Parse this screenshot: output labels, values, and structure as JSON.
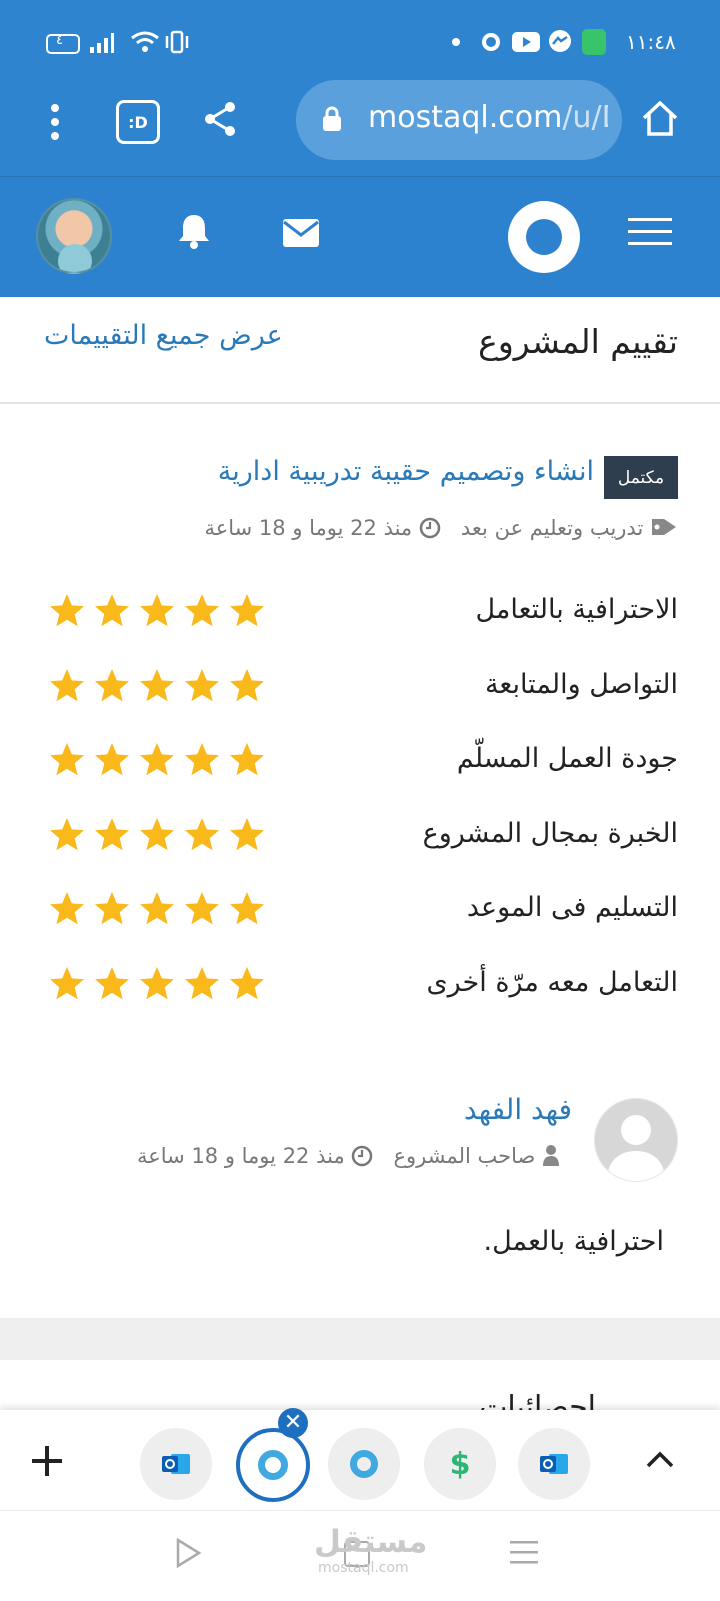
{
  "status_bar": {
    "time": "١١:٤٨",
    "battery_level": "٤"
  },
  "browser": {
    "url_main": "mostaql.com",
    "url_rest": "/u/D"
  },
  "section": {
    "title": "تقييم المشروع",
    "view_all_link": "عرض جميع التقييمات"
  },
  "project": {
    "status_badge": "مكتمل",
    "title": "انشاء وتصميم حقيبة تدريبية ادارية",
    "category": "تدريب وتعليم عن بعد",
    "time_ago": "منذ 22 يوما و 18 ساعة"
  },
  "ratings": [
    {
      "label": "الاحترافية بالتعامل",
      "stars": 5
    },
    {
      "label": "التواصل والمتابعة",
      "stars": 5
    },
    {
      "label": "جودة العمل المسلّم",
      "stars": 5
    },
    {
      "label": "الخبرة بمجال المشروع",
      "stars": 5
    },
    {
      "label": "التسليم فى الموعد",
      "stars": 5
    },
    {
      "label": "التعامل معه مرّة أخرى",
      "stars": 5
    }
  ],
  "review": {
    "reviewer_name": "فهد الفهد",
    "reviewer_role": "صاحب المشروع",
    "time_ago": "منذ 22 يوما و 18 ساعة",
    "text": "احترافية بالعمل."
  },
  "next_section_peek": "إحصائيات",
  "colors": {
    "brand_blue": "#2f84cf",
    "link_blue": "#2a7ab8",
    "star_gold": "#f9b91b",
    "badge_dark": "#2f3e4e"
  },
  "icons": {
    "menu": "hamburger-icon",
    "bell": "bell-icon",
    "mail": "envelope-icon",
    "home": "home-icon",
    "share": "share-icon",
    "lock": "lock-icon",
    "tag": "tag-icon",
    "clock": "clock-icon",
    "user": "user-icon"
  },
  "watermark": {
    "arabic": "مستقل",
    "latin": "mostaql.com"
  }
}
